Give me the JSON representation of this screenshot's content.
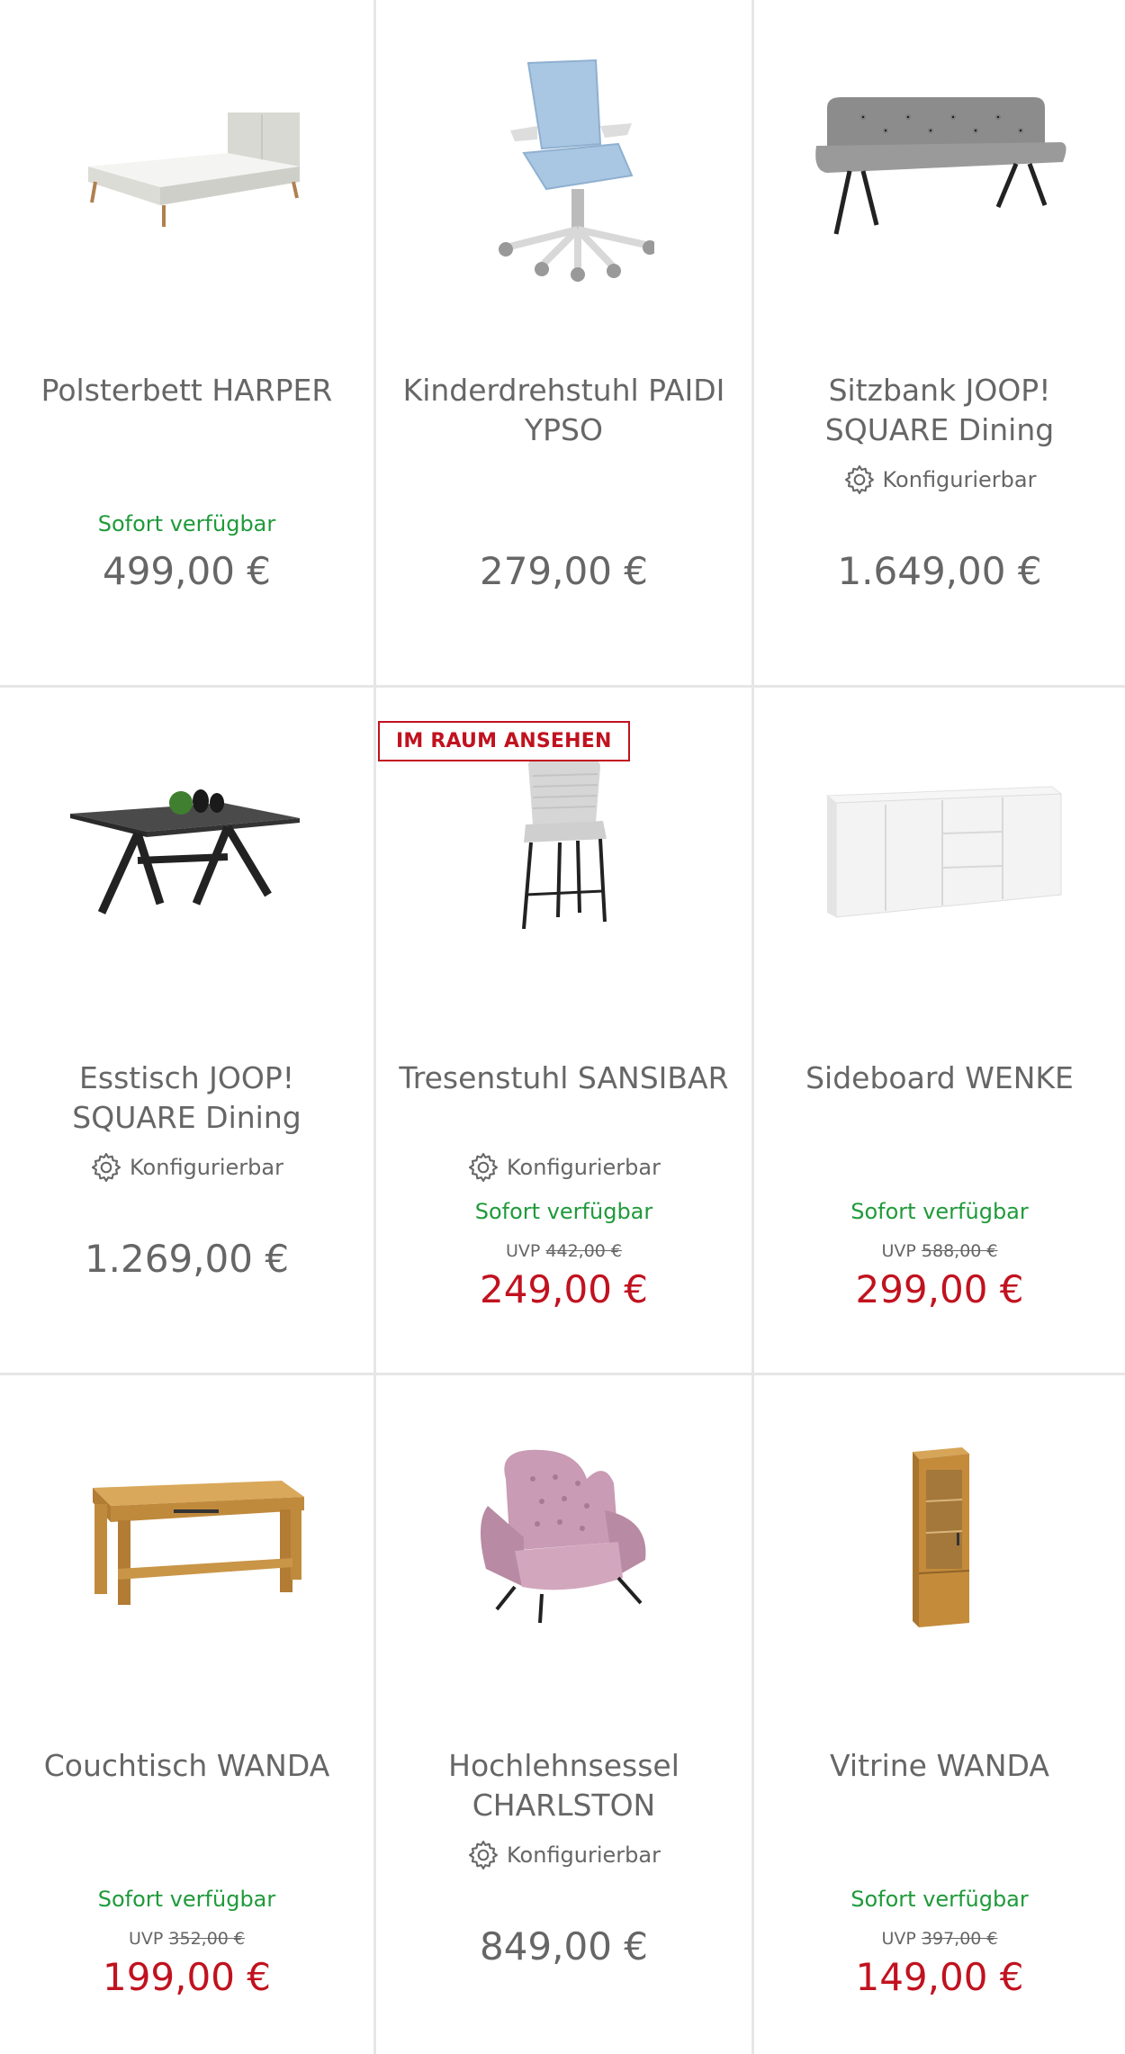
{
  "colors": {
    "available_green": "#1f9a3a",
    "sale_red": "#c1121f",
    "text_gray": "#666666",
    "divider": "#e6e6e6"
  },
  "products": [
    {
      "title": "Polsterbett HARPER",
      "image_icon": "upholstered-bed-image",
      "configurable": "",
      "availability": "Sofort verfügbar",
      "uvp_label": "",
      "uvp_price": "",
      "price": "499,00 €",
      "badge": ""
    },
    {
      "title": "Kinderdrehstuhl PAIDI YPSO",
      "image_icon": "swivel-chair-image",
      "configurable": "",
      "availability": "",
      "uvp_label": "",
      "uvp_price": "",
      "price": "279,00 €",
      "badge": ""
    },
    {
      "title": "Sitzbank JOOP! SQUARE Dining",
      "image_icon": "bench-image",
      "configurable": "Konfigurierbar",
      "availability": "",
      "uvp_label": "",
      "uvp_price": "",
      "price": "1.649,00 €",
      "badge": ""
    },
    {
      "title": "Esstisch JOOP! SQUARE Dining",
      "image_icon": "dining-table-image",
      "configurable": "Konfigurierbar",
      "availability": "",
      "uvp_label": "",
      "uvp_price": "",
      "price": "1.269,00 €",
      "badge": ""
    },
    {
      "title": "Tresenstuhl SANSIBAR",
      "image_icon": "bar-stool-image",
      "configurable": "Konfigurierbar",
      "availability": "Sofort verfügbar",
      "uvp_label": "UVP",
      "uvp_price": "442,00 €",
      "price": "249,00 €",
      "badge": "IM RAUM ANSEHEN"
    },
    {
      "title": "Sideboard WENKE",
      "image_icon": "sideboard-image",
      "configurable": "",
      "availability": "Sofort verfügbar",
      "uvp_label": "UVP",
      "uvp_price": "588,00 €",
      "price": "299,00 €",
      "badge": ""
    },
    {
      "title": "Couchtisch WANDA",
      "image_icon": "coffee-table-image",
      "configurable": "",
      "availability": "Sofort verfügbar",
      "uvp_label": "UVP",
      "uvp_price": "352,00 €",
      "price": "199,00 €",
      "badge": ""
    },
    {
      "title": "Hochlehnsessel CHARLSTON",
      "image_icon": "wingback-armchair-image",
      "configurable": "Konfigurierbar",
      "availability": "",
      "uvp_label": "",
      "uvp_price": "",
      "price": "849,00 €",
      "badge": ""
    },
    {
      "title": "Vitrine WANDA",
      "image_icon": "display-cabinet-image",
      "configurable": "",
      "availability": "Sofort verfügbar",
      "uvp_label": "UVP",
      "uvp_price": "397,00 €",
      "price": "149,00 €",
      "badge": ""
    }
  ]
}
